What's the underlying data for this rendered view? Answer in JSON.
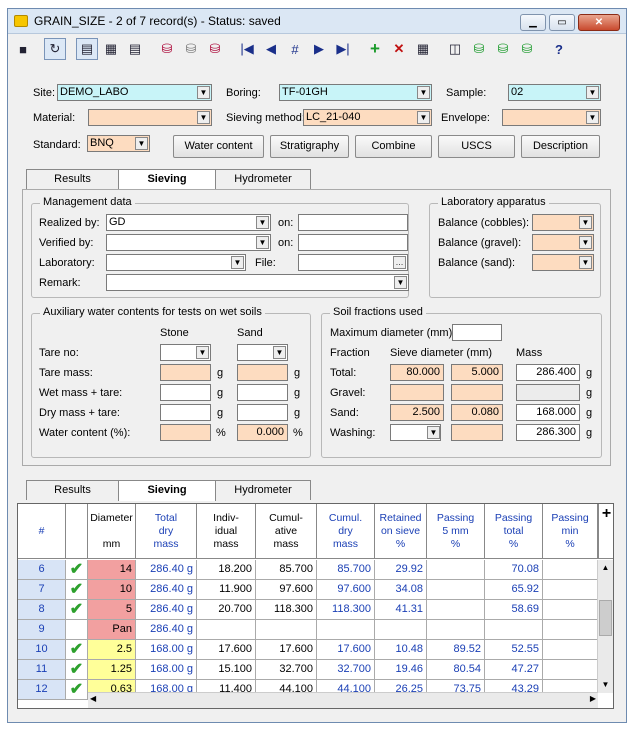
{
  "window": {
    "title": "GRAIN_SIZE - 2 of 7 record(s) - Status: saved",
    "min": "▁",
    "max": "▭",
    "close": "✕"
  },
  "toolbar": {
    "icons": [
      "save-icon",
      "refresh-icon",
      "form-view-icon",
      "grid-view-icon",
      "list-view-icon",
      "db-icon",
      "db-multi-icon",
      "db-delete-icon",
      "first-record-icon",
      "prev-record-icon",
      "goto-record-icon",
      "next-record-icon",
      "last-record-icon",
      "add-record-icon",
      "delete-record-icon",
      "copy-record-icon",
      "export-icon",
      "db-export-icon",
      "db-import-icon",
      "db-link-icon",
      "help-icon"
    ]
  },
  "header": {
    "site_label": "Site:",
    "site_value": "DEMO_LABO",
    "boring_label": "Boring:",
    "boring_value": "TF-01GH",
    "sample_label": "Sample:",
    "sample_value": "02",
    "material_label": "Material:",
    "material_value": "",
    "sieving_label": "Sieving method:",
    "sieving_value": "LC_21-040",
    "envelope_label": "Envelope:",
    "envelope_value": "",
    "standard_label": "Standard:",
    "standard_value": "BNQ",
    "buttons": [
      "Water content",
      "Stratigraphy",
      "Combine",
      "USCS",
      "Description"
    ]
  },
  "tabs": [
    "Results",
    "Sieving",
    "Hydrometer"
  ],
  "management": {
    "title": "Management data",
    "realized_label": "Realized by:",
    "realized_value": "GD",
    "verified_label": "Verified by:",
    "verified_value": "",
    "lab_label": "Laboratory:",
    "lab_value": "",
    "remark_label": "Remark:",
    "remark_value": "",
    "on_label": "on:",
    "file_label": "File:"
  },
  "apparatus": {
    "title": "Laboratory apparatus",
    "cobbles": "Balance (cobbles):",
    "gravel": "Balance (gravel):",
    "sand": "Balance (sand):"
  },
  "aux": {
    "title": "Auxiliary water contents for tests on wet soils",
    "stone": "Stone",
    "sand": "Sand",
    "rows": [
      "Tare no:",
      "Tare mass:",
      "Wet mass + tare:",
      "Dry mass + tare:",
      "Water content (%):"
    ],
    "units": [
      "",
      "g",
      "g",
      "g",
      "%"
    ],
    "water_sand": "0.000"
  },
  "fractions": {
    "title": "Soil fractions used",
    "maxdiam_label": "Maximum diameter (mm)",
    "fraction": "Fraction",
    "sieve": "Sieve diameter (mm)",
    "mass": "Mass",
    "rows": [
      {
        "label": "Total:",
        "d1": "80.000",
        "d2": "5.000",
        "mass": "286.400"
      },
      {
        "label": "Gravel:",
        "d1": "",
        "d2": "",
        "mass": ""
      },
      {
        "label": "Sand:",
        "d1": "2.500",
        "d2": "0.080",
        "mass": "168.000"
      },
      {
        "label": "Washing:",
        "d1": "",
        "d2": "",
        "mass": "286.300"
      }
    ],
    "unit": "g"
  },
  "grid": {
    "headers": [
      "#",
      "",
      "Diameter\n\nmm",
      "Total\ndry\nmass",
      "Indiv-\nidual\nmass",
      "Cumul-\native\nmass",
      "Cumul.\ndry\nmass",
      "Retained\non sieve\n%",
      "Passing\n5 mm\n%",
      "Passing\ntotal\n%",
      "Passing\nmin\n%"
    ],
    "rows": [
      {
        "n": "6",
        "chk": true,
        "d": "14",
        "tdm": "286.40 g",
        "ind": "18.200",
        "cum": "85.700",
        "cdm": "85.700",
        "ret": "29.92",
        "p5": "",
        "pt": "70.08",
        "pm": "",
        "color": "red"
      },
      {
        "n": "7",
        "chk": true,
        "d": "10",
        "tdm": "286.40 g",
        "ind": "11.900",
        "cum": "97.600",
        "cdm": "97.600",
        "ret": "34.08",
        "p5": "",
        "pt": "65.92",
        "pm": "",
        "color": "red"
      },
      {
        "n": "8",
        "chk": true,
        "d": "5",
        "tdm": "286.40 g",
        "ind": "20.700",
        "cum": "118.300",
        "cdm": "118.300",
        "ret": "41.31",
        "p5": "",
        "pt": "58.69",
        "pm": "",
        "color": "red"
      },
      {
        "n": "9",
        "chk": false,
        "d": "Pan",
        "tdm": "286.40 g",
        "ind": "",
        "cum": "",
        "cdm": "",
        "ret": "",
        "p5": "",
        "pt": "",
        "pm": "",
        "color": "red"
      },
      {
        "n": "10",
        "chk": true,
        "d": "2.5",
        "tdm": "168.00 g",
        "ind": "17.600",
        "cum": "17.600",
        "cdm": "17.600",
        "ret": "10.48",
        "p5": "89.52",
        "pt": "52.55",
        "pm": "",
        "color": "yel"
      },
      {
        "n": "11",
        "chk": true,
        "d": "1.25",
        "tdm": "168.00 g",
        "ind": "15.100",
        "cum": "32.700",
        "cdm": "32.700",
        "ret": "19.46",
        "p5": "80.54",
        "pt": "47.27",
        "pm": "",
        "color": "yel"
      },
      {
        "n": "12",
        "chk": true,
        "d": "0.63",
        "tdm": "168.00 g",
        "ind": "11.400",
        "cum": "44.100",
        "cdm": "44.100",
        "ret": "26.25",
        "p5": "73.75",
        "pt": "43.29",
        "pm": "",
        "color": "yel"
      }
    ]
  }
}
